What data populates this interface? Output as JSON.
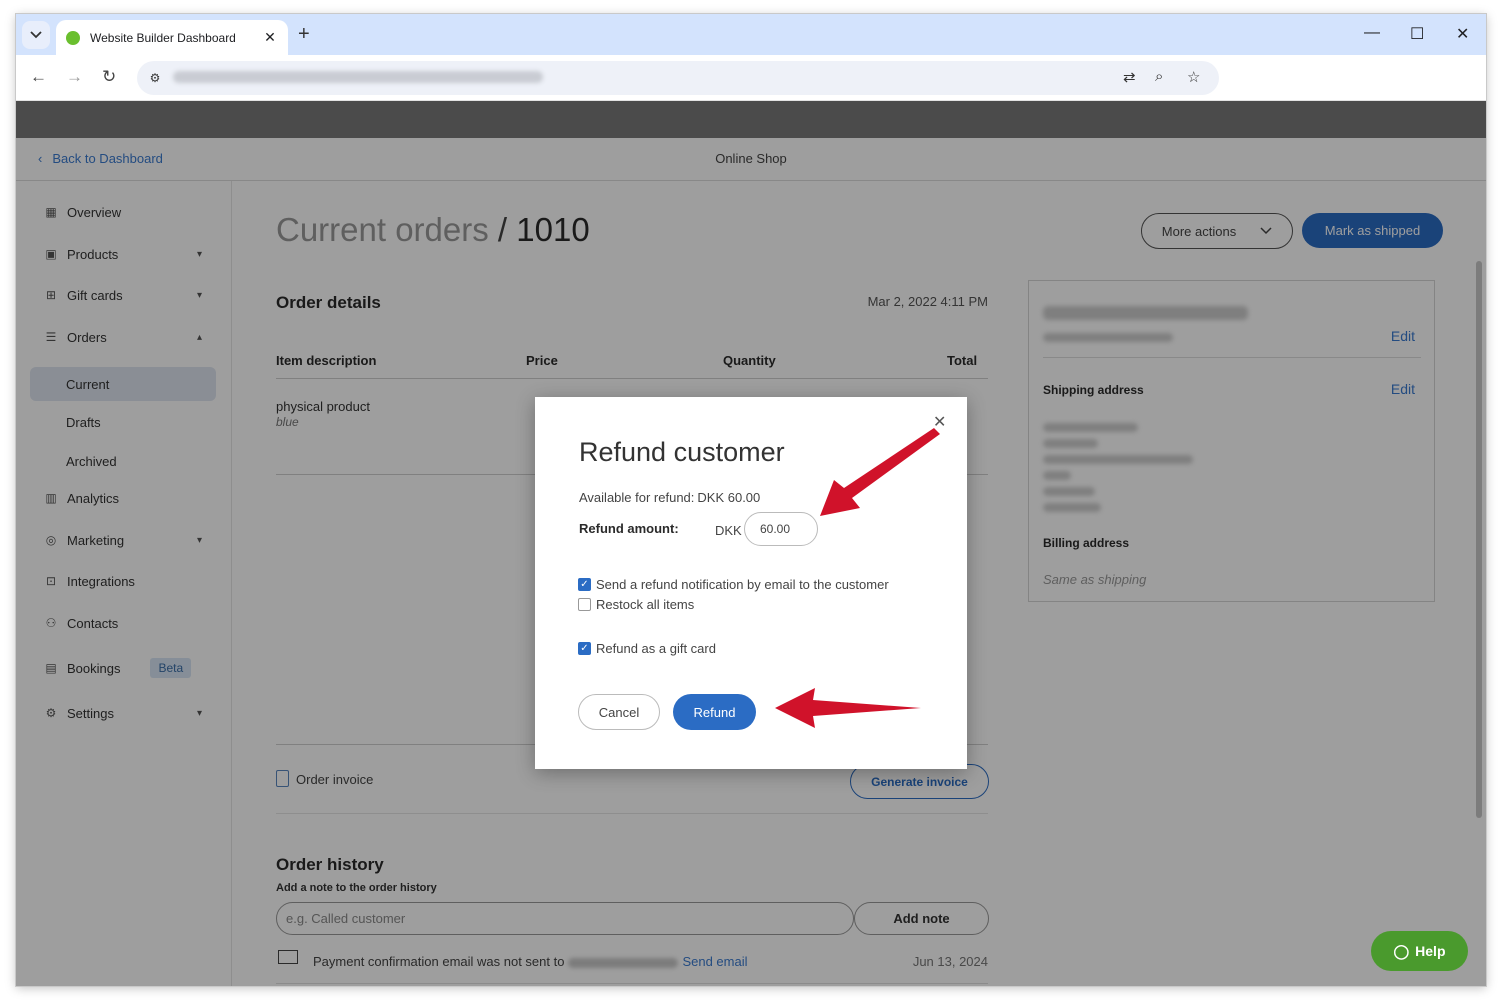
{
  "browser": {
    "tab_title": "Website Builder Dashboard",
    "new_tab": "+",
    "close_tab": "✕",
    "minimize": "—",
    "maximize": "☐",
    "close_window": "✕"
  },
  "header": {
    "back_label": "Back to Dashboard",
    "shop_name": "Online Shop"
  },
  "sidebar": {
    "items": [
      {
        "label": "Overview",
        "icon": "grid-icon"
      },
      {
        "label": "Products",
        "icon": "box-icon"
      },
      {
        "label": "Gift cards",
        "icon": "gift-icon"
      },
      {
        "label": "Orders",
        "icon": "orders-icon"
      },
      {
        "label": "Analytics",
        "icon": "bar-chart-icon"
      },
      {
        "label": "Marketing",
        "icon": "target-icon"
      },
      {
        "label": "Integrations",
        "icon": "puzzle-icon"
      },
      {
        "label": "Contacts",
        "icon": "people-icon"
      },
      {
        "label": "Bookings",
        "icon": "calendar-icon"
      },
      {
        "label": "Settings",
        "icon": "gear-icon"
      }
    ],
    "orders_sub": [
      "Current",
      "Drafts",
      "Archived"
    ],
    "beta_badge": "Beta"
  },
  "main": {
    "title_prefix": "Current orders",
    "title_sep": " / ",
    "order_number": "1010",
    "more_actions": "More actions",
    "mark_shipped": "Mark as shipped",
    "order_details_title": "Order details",
    "order_date": "Mar 2, 2022 4:11 PM",
    "columns": [
      "Item description",
      "Price",
      "Quantity",
      "Total"
    ],
    "item": {
      "name": "physical product",
      "variant": "blue"
    },
    "invoice_label": "Order invoice",
    "generate_invoice": "Generate invoice",
    "history_title": "Order history",
    "note_label": "Add a note to the order history",
    "note_placeholder": "e.g. Called customer",
    "add_note": "Add note",
    "history_row": {
      "text_before": "Payment confirmation email was not sent to",
      "link": "Send email",
      "date": "Jun 13, 2024"
    }
  },
  "customer_card": {
    "edit_label": "Edit",
    "shipping_label": "Shipping address",
    "billing_label": "Billing address",
    "billing_note": "Same as shipping"
  },
  "modal": {
    "title": "Refund customer",
    "available_label": "Available for refund:",
    "available_value": "DKK 60.00",
    "amount_label": "Refund amount:",
    "currency": "DKK",
    "amount_value": "60.00",
    "notify_label": "Send a refund notification by email to the customer",
    "restock_label": "Restock all items",
    "giftcard_label": "Refund as a gift card",
    "cancel": "Cancel",
    "refund": "Refund"
  },
  "help": {
    "label": "Help"
  },
  "colors": {
    "accent": "#2b6cc4",
    "help_green": "#4a9a2d",
    "arrow_red": "#d0122a"
  }
}
